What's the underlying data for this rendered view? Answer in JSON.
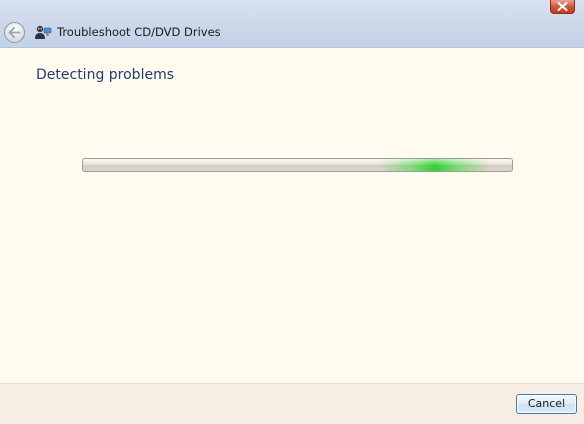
{
  "window": {
    "title": "Troubleshoot CD/DVD Drives"
  },
  "icons": {
    "back": "back-arrow-icon",
    "app": "troubleshooter-icon",
    "close": "close-icon"
  },
  "main": {
    "heading": "Detecting problems",
    "progress": {
      "mode": "indeterminate",
      "glow_center_fraction": 0.82
    }
  },
  "footer": {
    "cancel_label": "Cancel"
  },
  "colors": {
    "heading": "#243b6e",
    "progress_glow": "#28d228",
    "close_button": "#c03b22",
    "background": "#fffbef"
  }
}
